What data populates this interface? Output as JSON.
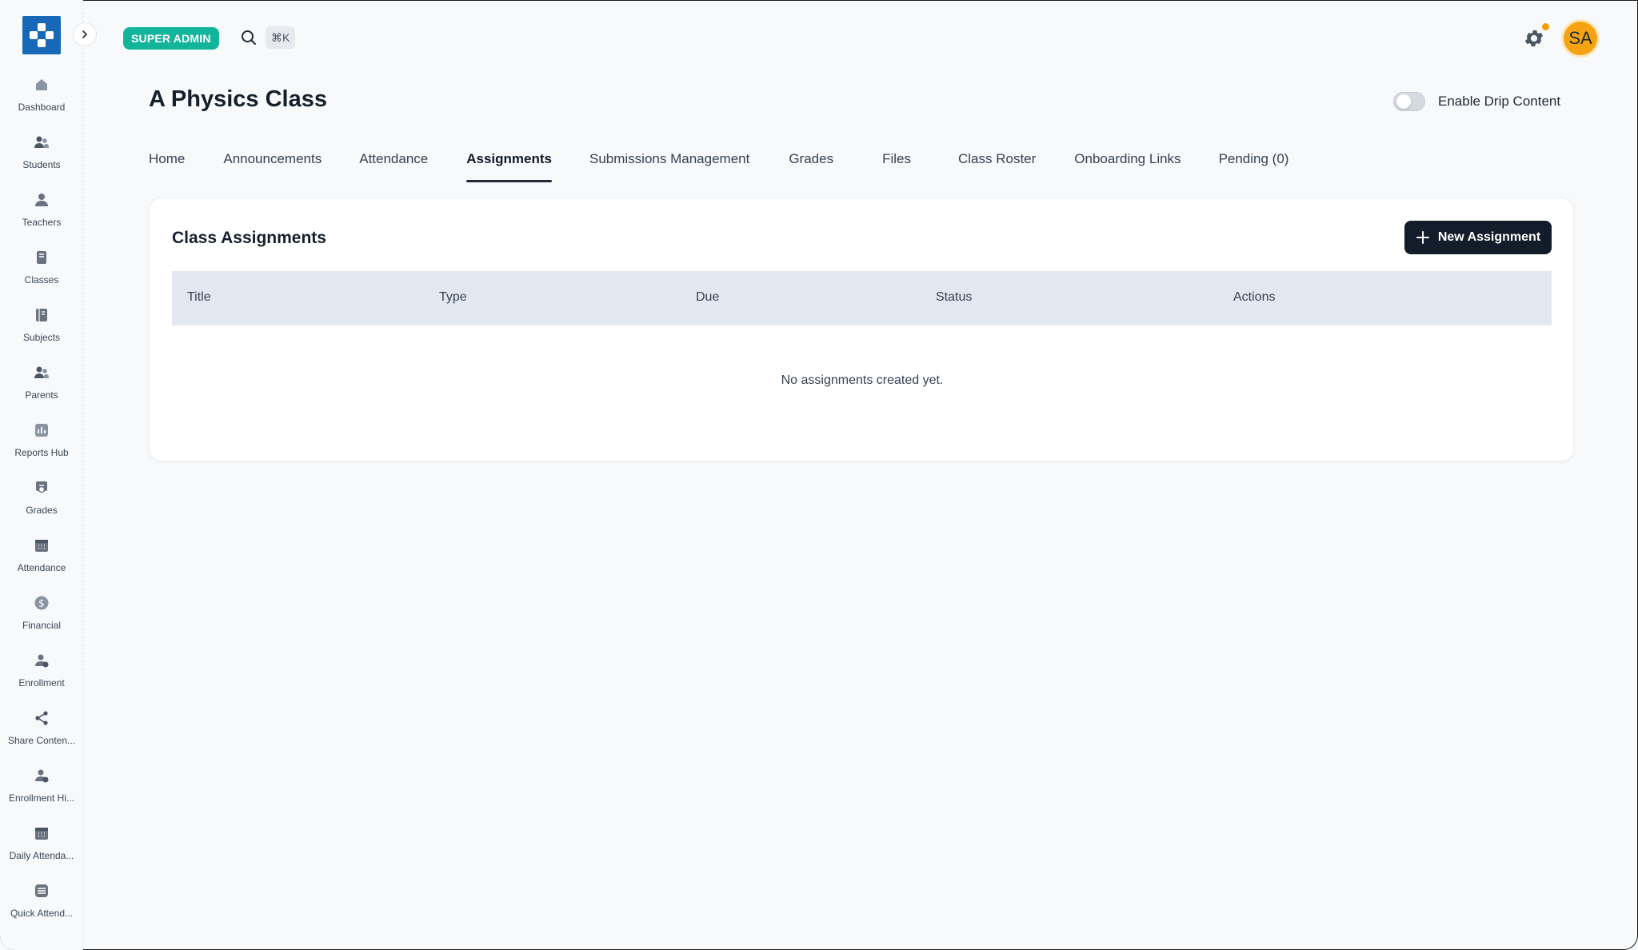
{
  "header": {
    "role_badge": "SUPER ADMIN",
    "shortcut": "⌘K",
    "avatar_initials": "SA",
    "notification_dot_color": "#f59e0b"
  },
  "sidebar": {
    "items": [
      {
        "label": "Dashboard",
        "icon": "home-icon"
      },
      {
        "label": "Students",
        "icon": "users-icon"
      },
      {
        "label": "Teachers",
        "icon": "user-icon"
      },
      {
        "label": "Classes",
        "icon": "book-icon"
      },
      {
        "label": "Subjects",
        "icon": "notebook-icon"
      },
      {
        "label": "Parents",
        "icon": "users-icon"
      },
      {
        "label": "Reports Hub",
        "icon": "bar-chart-icon"
      },
      {
        "label": "Grades",
        "icon": "award-icon"
      },
      {
        "label": "Attendance",
        "icon": "calendar-icon"
      },
      {
        "label": "Financial",
        "icon": "dollar-icon"
      },
      {
        "label": "Enrollment",
        "icon": "user-plus-icon"
      },
      {
        "label": "Share Conten...",
        "icon": "share-icon"
      },
      {
        "label": "Enrollment Hi...",
        "icon": "user-clock-icon"
      },
      {
        "label": "Daily Attenda...",
        "icon": "calendar-icon"
      },
      {
        "label": "Quick Attend...",
        "icon": "list-check-icon"
      }
    ]
  },
  "page": {
    "title": "A Physics Class",
    "drip_label": "Enable Drip Content",
    "drip_enabled": false
  },
  "tabs": [
    {
      "label": "Home",
      "active": false
    },
    {
      "label": "Announcements",
      "active": false
    },
    {
      "label": "Attendance",
      "active": false
    },
    {
      "label": "Assignments",
      "active": true
    },
    {
      "label": "Submissions Management",
      "active": false
    },
    {
      "label": "Grades",
      "active": false
    },
    {
      "label": "Files",
      "active": false
    },
    {
      "label": "Class Roster",
      "active": false
    },
    {
      "label": "Onboarding Links",
      "active": false
    },
    {
      "label": "Pending (0)",
      "active": false
    }
  ],
  "assignments": {
    "title": "Class Assignments",
    "new_button": "New Assignment",
    "columns": [
      "Title",
      "Type",
      "Due",
      "Status",
      "Actions"
    ],
    "rows": [],
    "empty_message": "No assignments created yet."
  },
  "colors": {
    "brand": "#1769b8",
    "badge": "#12b59a",
    "primary_button": "#131c2b",
    "avatar": "#f6a313"
  }
}
